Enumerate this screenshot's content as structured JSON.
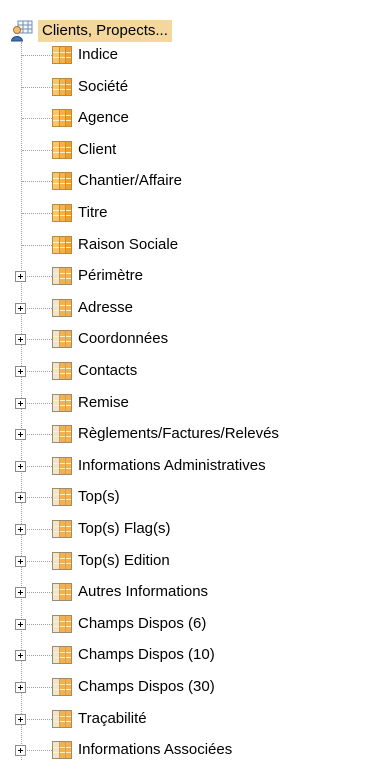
{
  "tree": {
    "root": {
      "label": "Clients, Propects..."
    },
    "items": [
      {
        "label": "Indice",
        "type": "field",
        "expandable": false
      },
      {
        "label": "Société",
        "type": "field",
        "expandable": false
      },
      {
        "label": "Agence",
        "type": "field",
        "expandable": false
      },
      {
        "label": "Client",
        "type": "field",
        "expandable": false
      },
      {
        "label": "Chantier/Affaire",
        "type": "field",
        "expandable": false
      },
      {
        "label": "Titre",
        "type": "field",
        "expandable": false
      },
      {
        "label": "Raison Sociale",
        "type": "field",
        "expandable": false
      },
      {
        "label": "Périmètre",
        "type": "table",
        "expandable": true
      },
      {
        "label": "Adresse",
        "type": "table",
        "expandable": true
      },
      {
        "label": "Coordonnées",
        "type": "table",
        "expandable": true
      },
      {
        "label": "Contacts",
        "type": "table",
        "expandable": true
      },
      {
        "label": "Remise",
        "type": "table",
        "expandable": true
      },
      {
        "label": "Règlements/Factures/Relevés",
        "type": "table",
        "expandable": true
      },
      {
        "label": "Informations Administratives",
        "type": "table",
        "expandable": true
      },
      {
        "label": "Top(s)",
        "type": "table",
        "expandable": true
      },
      {
        "label": "Top(s) Flag(s)",
        "type": "table",
        "expandable": true
      },
      {
        "label": "Top(s) Edition",
        "type": "table",
        "expandable": true
      },
      {
        "label": "Autres Informations",
        "type": "table",
        "expandable": true
      },
      {
        "label": "Champs Dispos (6)",
        "type": "table",
        "expandable": true
      },
      {
        "label": "Champs Dispos (10)",
        "type": "table",
        "expandable": true
      },
      {
        "label": "Champs Dispos (30)",
        "type": "table",
        "expandable": true
      },
      {
        "label": "Traçabilité",
        "type": "table",
        "expandable": true
      },
      {
        "label": "Informations Associées",
        "type": "table",
        "expandable": true
      }
    ]
  },
  "colors": {
    "selection": "#f3d79d",
    "guide": "#a0a0a0",
    "icon_orange": "#f4b14c"
  }
}
